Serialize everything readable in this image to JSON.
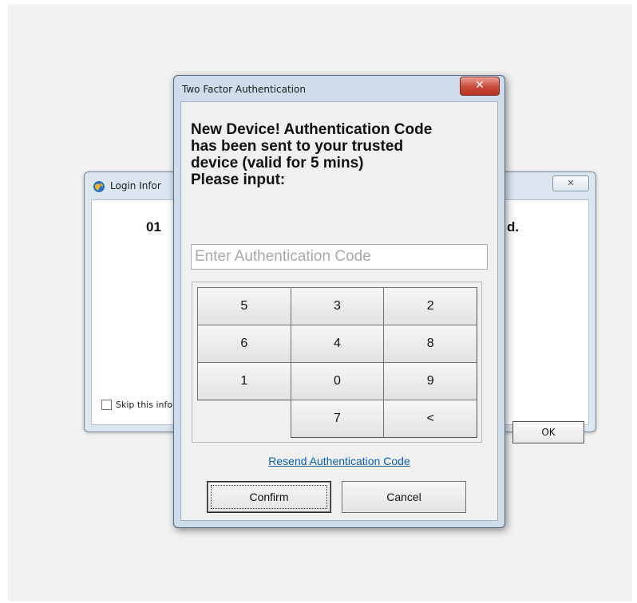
{
  "background_window": {
    "title": "Login Infor",
    "close_glyph": "✕",
    "message_left": "01",
    "message_right": "d.",
    "skip_label": "Skip this info",
    "ok_label": "OK",
    "icon": "app-globe-icon"
  },
  "dialog": {
    "title": "Two Factor Authentication",
    "close_glyph": "✕",
    "instructions": {
      "line1": "New Device! Authentication Code",
      "line2": "has been sent to your trusted",
      "line3": "device (valid for 5 mins)",
      "line4": "Please input:"
    },
    "code_input": {
      "value": "",
      "placeholder": "Enter Authentication Code"
    },
    "keypad": {
      "keys": [
        "5",
        "3",
        "2",
        "6",
        "4",
        "8",
        "1",
        "0",
        "9",
        "",
        "7",
        "<"
      ]
    },
    "resend_link": "Resend Authentication Code",
    "confirm_label": "Confirm",
    "cancel_label": "Cancel"
  },
  "colors": {
    "link": "#0a5fb4",
    "close_button": "#c8493a",
    "window_frame": "#cfdcea"
  }
}
